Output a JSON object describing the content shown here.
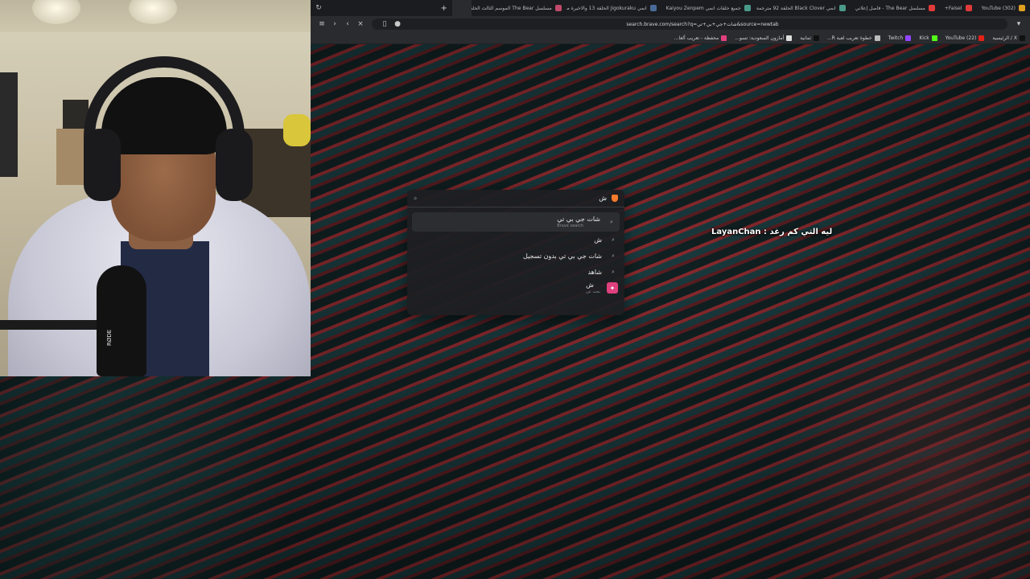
{
  "tabs": [
    {
      "title": "(302) YouTube",
      "color": "#e0a020",
      "active": false
    },
    {
      "title": "Faisel+",
      "color": "#e03a3a",
      "active": false
    },
    {
      "title": "مسلسل The Bear - فاصل إعلاني",
      "color": "#e03a3a",
      "active": false
    },
    {
      "title": "انمي Black Clover الحلقة 92 مترجمة ا",
      "color": "#4a9a8a",
      "active": false
    },
    {
      "title": "جميع حلقات انمي Kaiyou Zenpem",
      "color": "#4a9a8a",
      "active": false
    },
    {
      "title": "انمي Jigokuraku الحلقة 13 والاخيرة مت",
      "color": "#4a6a9a",
      "active": false
    },
    {
      "title": "مسلسل The Bear الموسم الثالث الحلقة",
      "color": "#c04a6a",
      "active": false
    },
    {
      "title": "",
      "color": "#2a2b2f",
      "active": true
    }
  ],
  "toolbar": {
    "url": "search.brave.com/search?q=شات+جي+بي+تي&source=newtab"
  },
  "bookmarks": [
    {
      "label": "X / الرئيسية",
      "color": "#111111"
    },
    {
      "label": "(22) YouTube",
      "color": "#e62117"
    },
    {
      "label": "Kick",
      "color": "#53fc18"
    },
    {
      "label": "Twitch",
      "color": "#9146ff"
    },
    {
      "label": "خطوة تعريب لعبة R...",
      "color": "#bbbbbb"
    },
    {
      "label": "ثمانية",
      "color": "#111111"
    },
    {
      "label": "أمازون السعودية: تسو...",
      "color": "#dddddd"
    },
    {
      "label": "محفظة - تعريب ألعا...",
      "color": "#e0407e"
    }
  ],
  "search": {
    "value": "ش",
    "suggestions": [
      {
        "text": "شات جي بي تي",
        "sub": "Brave search",
        "icon": "search-icon",
        "highlight": true
      },
      {
        "text": "ش",
        "sub": "",
        "icon": "search-icon",
        "highlight": false
      },
      {
        "text": "شات جي بي تي بدون تسجيل",
        "sub": "",
        "icon": "search-icon",
        "highlight": false
      },
      {
        "text": "شاهد",
        "sub": "",
        "icon": "search-icon",
        "highlight": false
      },
      {
        "text": "ش",
        "sub": "بحث عن",
        "icon": "brave-leo-icon",
        "highlight": false
      }
    ]
  },
  "chat": {
    "text": "LayanChan : ليه التي كم رغد"
  },
  "webcam": {
    "logo": "RØDE"
  }
}
